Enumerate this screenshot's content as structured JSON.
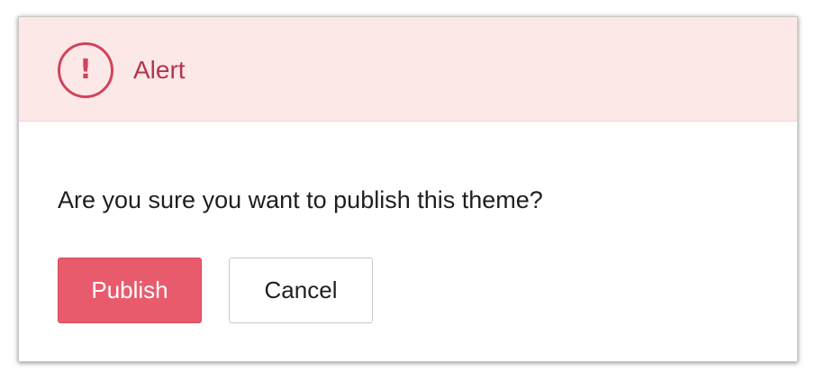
{
  "dialog": {
    "title": "Alert",
    "icon": "alert-circle-icon",
    "icon_glyph": "!",
    "message": "Are you sure you want to publish this theme?",
    "buttons": {
      "primary_label": "Publish",
      "secondary_label": "Cancel"
    }
  },
  "colors": {
    "header_background": "#fde8e8",
    "alert_accent": "#d1445a",
    "primary_button": "#e85b6d"
  }
}
